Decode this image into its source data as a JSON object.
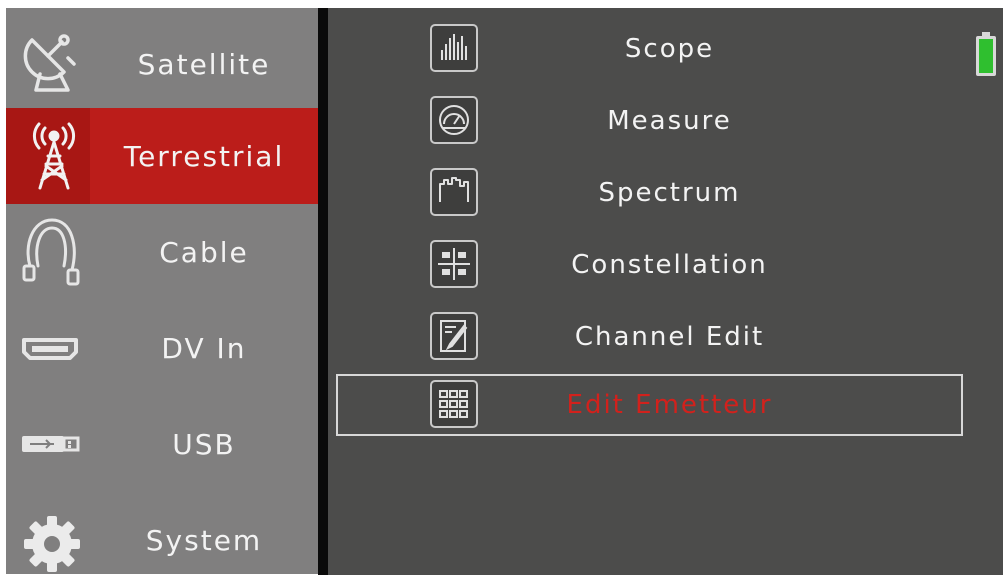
{
  "sidebar": {
    "items": [
      {
        "label": "Satellite",
        "icon": "satellite-dish-icon"
      },
      {
        "label": "Terrestrial",
        "icon": "antenna-tower-icon",
        "active": true
      },
      {
        "label": "Cable",
        "icon": "cable-icon"
      },
      {
        "label": "DV In",
        "icon": "hdmi-port-icon"
      },
      {
        "label": "USB",
        "icon": "usb-stick-icon"
      },
      {
        "label": "System",
        "icon": "gear-icon"
      }
    ]
  },
  "menu": {
    "items": [
      {
        "label": "Scope",
        "icon": "scope-bars-icon"
      },
      {
        "label": "Measure",
        "icon": "gauge-icon"
      },
      {
        "label": "Spectrum",
        "icon": "spectrum-icon"
      },
      {
        "label": "Constellation",
        "icon": "constellation-icon"
      },
      {
        "label": "Channel Edit",
        "icon": "edit-note-icon"
      },
      {
        "label": "Edit Emetteur",
        "icon": "grid-keypad-icon",
        "selected": true
      }
    ]
  },
  "status": {
    "battery_icon": "battery-icon",
    "battery_color": "#2fbf2f"
  },
  "colors": {
    "active": "#bb1d1a",
    "selected_text": "#d2211c",
    "sidebar_bg": "#807f7f",
    "main_bg": "#4c4c4b"
  }
}
